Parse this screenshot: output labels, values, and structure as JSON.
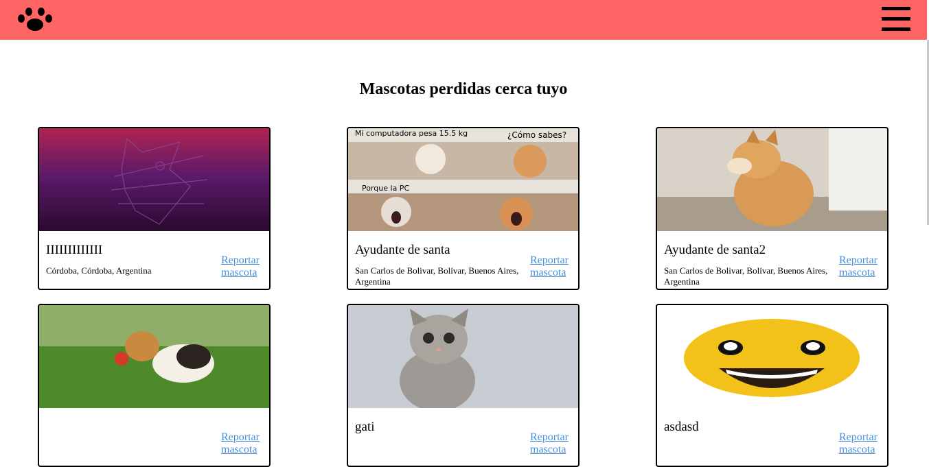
{
  "header": {
    "logo_icon": "paw-icon",
    "menu_icon": "hamburger-menu-icon",
    "bg_color": "#ff6565"
  },
  "page": {
    "title": "Mascotas perdidas cerca tuyo"
  },
  "meme_text": {
    "top_left": "Mi computadora pesa 15.5 kg",
    "top_right": "¿Cómo sabes?",
    "middle": "Porque la PC"
  },
  "pets": [
    {
      "name": "IIIIIIIIIIIII",
      "location": "Córdoba, Córdoba, Argentina",
      "report_label": "Reportar mascota",
      "image": "ubuntu-purple-rat"
    },
    {
      "name": "Ayudante de santa",
      "location": "San Carlos de Bolivar, Bolívar, Buenos Aires, Argentina",
      "report_label": "Reportar mascota",
      "image": "cat-meme"
    },
    {
      "name": "Ayudante de santa2",
      "location": "San Carlos de Bolivar, Bolívar, Buenos Aires, Argentina",
      "report_label": "Reportar mascota",
      "image": "shiba-dog"
    },
    {
      "name": "",
      "location": "",
      "report_label": "Reportar mascota",
      "image": "beagle-puppy"
    },
    {
      "name": "gati",
      "location": "",
      "report_label": "Reportar mascota",
      "image": "tabby-kitten"
    },
    {
      "name": "asdasd",
      "location": "",
      "report_label": "Reportar mascota",
      "image": "smiley-face"
    }
  ]
}
